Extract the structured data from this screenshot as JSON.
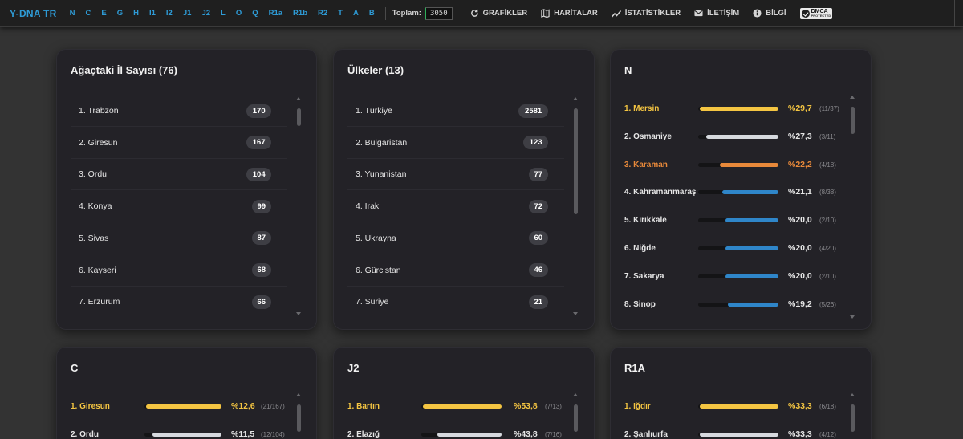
{
  "header": {
    "brand": "Y-DNA TR",
    "haplogroups": [
      "N",
      "C",
      "E",
      "G",
      "H",
      "I1",
      "I2",
      "J1",
      "J2",
      "L",
      "O",
      "Q",
      "R1a",
      "R1b",
      "R2",
      "T",
      "A",
      "B"
    ],
    "total_label": "Toplam:",
    "total_value": "3050",
    "nav": [
      {
        "label": "GRAFİKLER",
        "icon": "chart-refresh-icon"
      },
      {
        "label": "HARİTALAR",
        "icon": "map-icon"
      },
      {
        "label": "İSTATİSTİKLER",
        "icon": "line-chart-icon"
      },
      {
        "label": "İLETİŞİM",
        "icon": "envelope-icon"
      },
      {
        "label": "BİLGİ",
        "icon": "info-icon"
      }
    ],
    "dmca_label": "DMCA",
    "dmca_sub": "PROTECTED"
  },
  "colors": {
    "accent": "#2e9bd6",
    "gold": "#f4c542",
    "silver": "#d6d9de",
    "bronze": "#e8893a",
    "blue": "#2f86c9"
  },
  "cards": {
    "provinces": {
      "title": "Ağaçtaki İl Sayısı (76)",
      "items": [
        {
          "label": "1. Trabzon",
          "count": "170"
        },
        {
          "label": "2. Giresun",
          "count": "167"
        },
        {
          "label": "3. Ordu",
          "count": "104"
        },
        {
          "label": "4. Konya",
          "count": "99"
        },
        {
          "label": "5. Sivas",
          "count": "87"
        },
        {
          "label": "6. Kayseri",
          "count": "68"
        },
        {
          "label": "7. Erzurum",
          "count": "66"
        }
      ]
    },
    "countries": {
      "title": "Ülkeler (13)",
      "items": [
        {
          "label": "1. Türkiye",
          "count": "2581"
        },
        {
          "label": "2. Bulgaristan",
          "count": "123"
        },
        {
          "label": "3. Yunanistan",
          "count": "77"
        },
        {
          "label": "4. Irak",
          "count": "72"
        },
        {
          "label": "5. Ukrayna",
          "count": "60"
        },
        {
          "label": "6. Gürcistan",
          "count": "46"
        },
        {
          "label": "7. Suriye",
          "count": "21"
        }
      ]
    },
    "n": {
      "title": "N",
      "items": [
        {
          "label": "1. Mersin",
          "pct": "%29,7",
          "cnt": "(11/37)",
          "value": 29.7,
          "tier": "gold"
        },
        {
          "label": "2. Osmaniye",
          "pct": "%27,3",
          "cnt": "(3/11)",
          "value": 27.3,
          "tier": "silver"
        },
        {
          "label": "3. Karaman",
          "pct": "%22,2",
          "cnt": "(4/18)",
          "value": 22.2,
          "tier": "bronze"
        },
        {
          "label": "4. Kahramanmaraş",
          "pct": "%21,1",
          "cnt": "(8/38)",
          "value": 21.1,
          "tier": "blue"
        },
        {
          "label": "5. Kırıkkale",
          "pct": "%20,0",
          "cnt": "(2/10)",
          "value": 20.0,
          "tier": "blue"
        },
        {
          "label": "6. Niğde",
          "pct": "%20,0",
          "cnt": "(4/20)",
          "value": 20.0,
          "tier": "blue"
        },
        {
          "label": "7. Sakarya",
          "pct": "%20,0",
          "cnt": "(2/10)",
          "value": 20.0,
          "tier": "blue"
        },
        {
          "label": "8. Sinop",
          "pct": "%19,2",
          "cnt": "(5/26)",
          "value": 19.2,
          "tier": "blue"
        }
      ]
    },
    "c": {
      "title": "C",
      "items": [
        {
          "label": "1. Giresun",
          "pct": "%12,6",
          "cnt": "(21/167)",
          "value": 12.6,
          "tier": "gold"
        },
        {
          "label": "2. Ordu",
          "pct": "%11,5",
          "cnt": "(12/104)",
          "value": 11.5,
          "tier": "silver"
        }
      ]
    },
    "j2": {
      "title": "J2",
      "items": [
        {
          "label": "1. Bartın",
          "pct": "%53,8",
          "cnt": "(7/13)",
          "value": 53.8,
          "tier": "gold"
        },
        {
          "label": "2. Elazığ",
          "pct": "%43,8",
          "cnt": "(7/16)",
          "value": 43.8,
          "tier": "silver"
        }
      ]
    },
    "r1a": {
      "title": "R1A",
      "items": [
        {
          "label": "1. Iğdır",
          "pct": "%33,3",
          "cnt": "(6/18)",
          "value": 33.3,
          "tier": "gold"
        },
        {
          "label": "2. Şanlıurfa",
          "pct": "%33,3",
          "cnt": "(4/12)",
          "value": 33.3,
          "tier": "silver"
        }
      ]
    }
  }
}
